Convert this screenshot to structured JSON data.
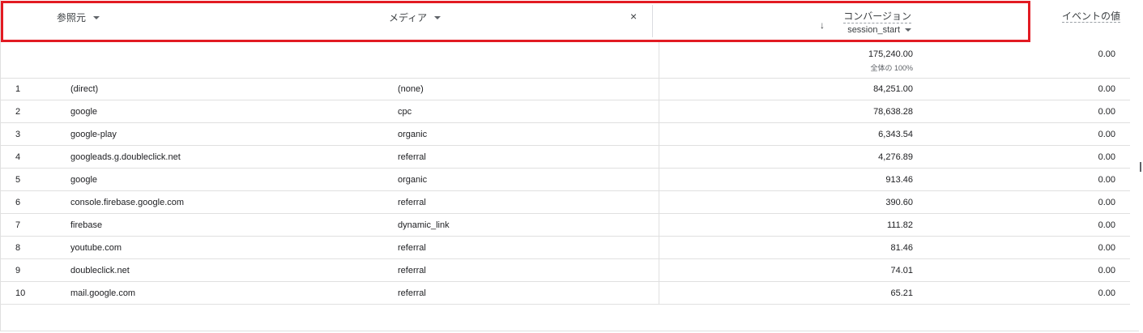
{
  "header": {
    "source_label": "参照元",
    "medium_label": "メディア",
    "close_glyph": "×",
    "sort_glyph": "↓",
    "conversions_label": "コンバージョン",
    "conversions_event": "session_start",
    "event_value_label": "イベントの値"
  },
  "totals": {
    "conversions": "175,240.00",
    "conversions_percent": "全体の 100%",
    "event_value": "0.00"
  },
  "colors": {
    "highlight": "#e21b23"
  },
  "rows": [
    {
      "num": "1",
      "source": "(direct)",
      "medium": "(none)",
      "conversions": "84,251.00",
      "event_value": "0.00"
    },
    {
      "num": "2",
      "source": "google",
      "medium": "cpc",
      "conversions": "78,638.28",
      "event_value": "0.00"
    },
    {
      "num": "3",
      "source": "google-play",
      "medium": "organic",
      "conversions": "6,343.54",
      "event_value": "0.00"
    },
    {
      "num": "4",
      "source": "googleads.g.doubleclick.net",
      "medium": "referral",
      "conversions": "4,276.89",
      "event_value": "0.00"
    },
    {
      "num": "5",
      "source": "google",
      "medium": "organic",
      "conversions": "913.46",
      "event_value": "0.00"
    },
    {
      "num": "6",
      "source": "console.firebase.google.com",
      "medium": "referral",
      "conversions": "390.60",
      "event_value": "0.00"
    },
    {
      "num": "7",
      "source": "firebase",
      "medium": "dynamic_link",
      "conversions": "111.82",
      "event_value": "0.00"
    },
    {
      "num": "8",
      "source": "youtube.com",
      "medium": "referral",
      "conversions": "81.46",
      "event_value": "0.00"
    },
    {
      "num": "9",
      "source": "doubleclick.net",
      "medium": "referral",
      "conversions": "74.01",
      "event_value": "0.00"
    },
    {
      "num": "10",
      "source": "mail.google.com",
      "medium": "referral",
      "conversions": "65.21",
      "event_value": "0.00"
    }
  ]
}
